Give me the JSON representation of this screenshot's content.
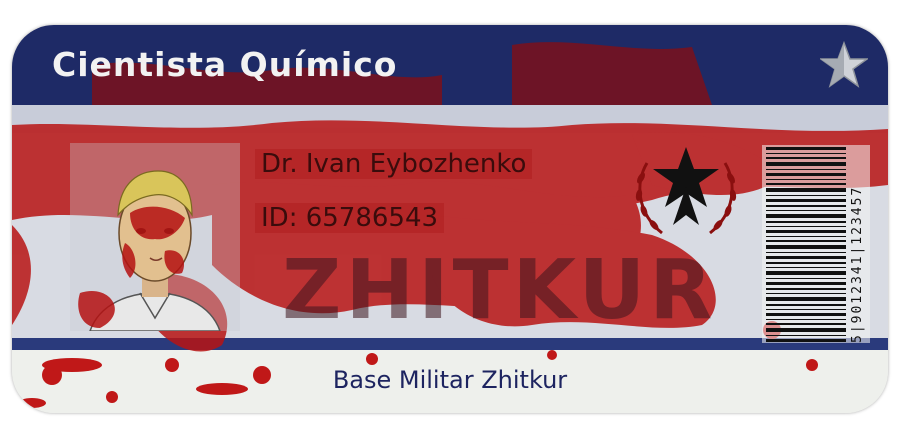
{
  "card": {
    "title": "Cientista Químico",
    "name": "Dr. Ivan Eybozhenko",
    "id_line": "ID: 65786543",
    "watermark": "ZHITKUR",
    "base": "Base Militar Zhitkur",
    "barcode_digits": "5|9012341|123457"
  },
  "icons": {
    "rank": "silver-star-icon",
    "emblem": "black-star-laurel-emblem"
  },
  "colors": {
    "navy": "#1e2a66",
    "blood": "#b51212",
    "background": "#e9ebe7"
  }
}
